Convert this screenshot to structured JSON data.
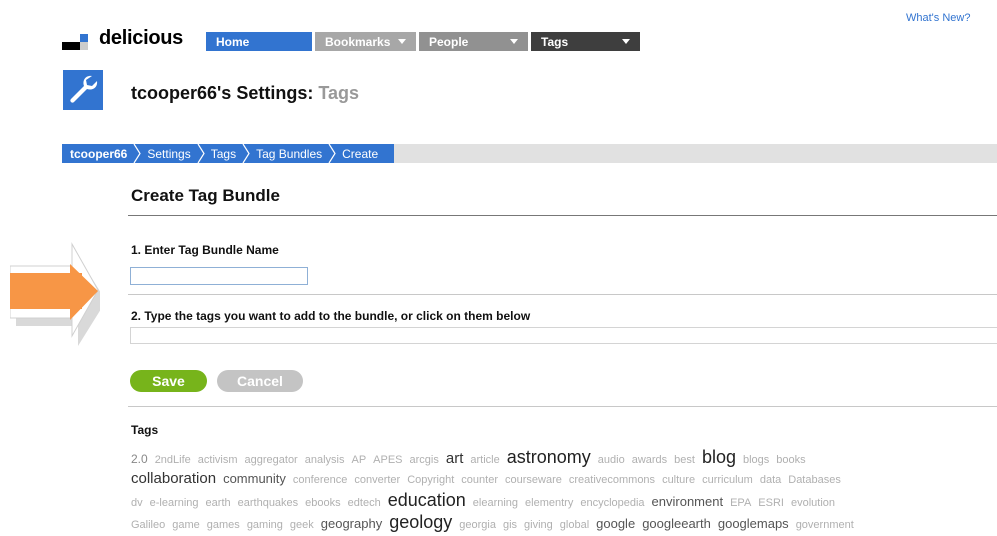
{
  "header": {
    "whats_new": "What's New?",
    "brand": "delicious",
    "logo_colors": [
      "#3274d0",
      "#000000",
      "#000000",
      "#cccccc"
    ]
  },
  "nav": {
    "home": "Home",
    "bookmarks": "Bookmarks",
    "people": "People",
    "tags": "Tags"
  },
  "page": {
    "title_main": "tcooper66's Settings:",
    "title_sub": "Tags"
  },
  "breadcrumb": [
    "tcooper66",
    "Settings",
    "Tags",
    "Tag Bundles",
    "Create"
  ],
  "form": {
    "heading": "Create Tag Bundle",
    "step1_label": "1. Enter Tag Bundle Name",
    "name_value": "",
    "step2_label": "2. Type the tags you want to add to the bundle, or click on them below",
    "tags_value": "",
    "save_label": "Save",
    "cancel_label": "Cancel"
  },
  "tag_cloud": {
    "heading": "Tags",
    "rows": [
      [
        [
          "2.0",
          2
        ],
        [
          "2ndLife",
          1
        ],
        [
          "activism",
          1
        ],
        [
          "aggregator",
          1
        ],
        [
          "analysis",
          1
        ],
        [
          "AP",
          1
        ],
        [
          "APES",
          1
        ],
        [
          "arcgis",
          1
        ],
        [
          "art",
          4
        ],
        [
          "article",
          1
        ],
        [
          "astronomy",
          5
        ],
        [
          "audio",
          1
        ],
        [
          "awards",
          1
        ],
        [
          "best",
          1
        ],
        [
          "blog",
          5
        ],
        [
          "blogs",
          1
        ],
        [
          "books",
          1
        ]
      ],
      [
        [
          "collaboration",
          4
        ],
        [
          "community",
          3
        ],
        [
          "conference",
          1
        ],
        [
          "converter",
          1
        ],
        [
          "Copyright",
          1
        ],
        [
          "counter",
          1
        ],
        [
          "courseware",
          1
        ],
        [
          "creativecommons",
          1
        ],
        [
          "culture",
          1
        ],
        [
          "curriculum",
          1
        ],
        [
          "data",
          1
        ],
        [
          "Databases",
          1
        ]
      ],
      [
        [
          "dv",
          1
        ],
        [
          "e-learning",
          1
        ],
        [
          "earth",
          1
        ],
        [
          "earthquakes",
          1
        ],
        [
          "ebooks",
          1
        ],
        [
          "edtech",
          1
        ],
        [
          "education",
          5
        ],
        [
          "elearning",
          1
        ],
        [
          "elementry",
          1
        ],
        [
          "encyclopedia",
          1
        ],
        [
          "environment",
          3
        ],
        [
          "EPA",
          1
        ],
        [
          "ESRI",
          1
        ],
        [
          "evolution",
          1
        ]
      ],
      [
        [
          "Galileo",
          1
        ],
        [
          "game",
          1
        ],
        [
          "games",
          1
        ],
        [
          "gaming",
          1
        ],
        [
          "geek",
          1
        ],
        [
          "geography",
          3
        ],
        [
          "geology",
          5
        ],
        [
          "georgia",
          1
        ],
        [
          "gis",
          1
        ],
        [
          "giving",
          1
        ],
        [
          "global",
          1
        ],
        [
          "google",
          3
        ],
        [
          "googleearth",
          3
        ],
        [
          "googlemaps",
          3
        ],
        [
          "government",
          1
        ]
      ]
    ]
  },
  "colors": {
    "accent_blue": "#3274d0",
    "save_green": "#77b41b",
    "cancel_gray": "#c4c4c4",
    "arrow_orange": "#f79646"
  }
}
